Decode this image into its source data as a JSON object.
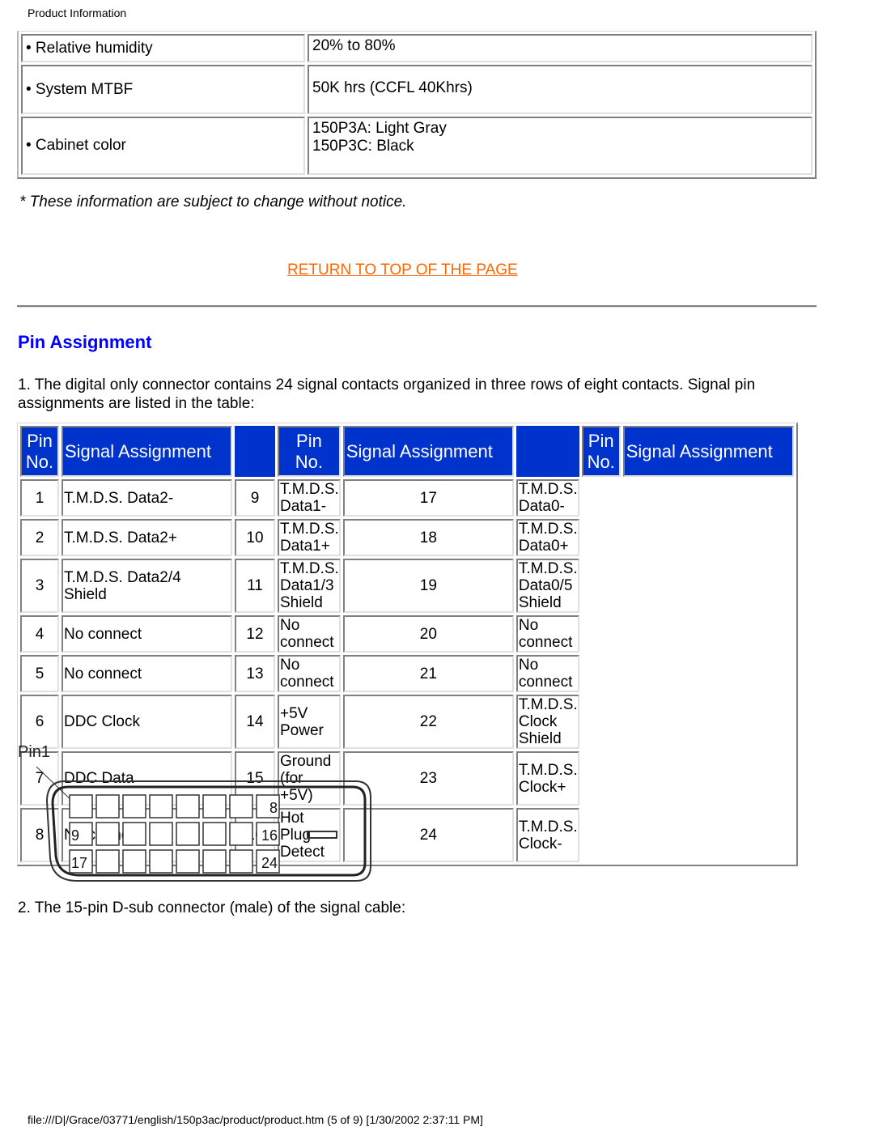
{
  "header": {
    "title": "Product Information"
  },
  "spec_table": {
    "rows": [
      {
        "label": "• Relative humidity",
        "value_lines": [
          "20% to 80%"
        ]
      },
      {
        "label": "• System MTBF",
        "value_lines": [
          "50K hrs (CCFL 40Khrs)"
        ]
      },
      {
        "label": "• Cabinet color",
        "value_lines": [
          "150P3A: Light Gray",
          "150P3C: Black"
        ]
      }
    ]
  },
  "notice": "* These information are subject to change without notice.",
  "return_link": "RETURN TO TOP OF THE PAGE",
  "section": {
    "title": "Pin Assignment",
    "intro": "1. The digital only connector contains 24 signal contacts organized in three rows of eight contacts. Signal pin assignments are listed in the table:"
  },
  "pin_table": {
    "header": {
      "pin_no_line1": "Pin",
      "pin_no_line2": "No.",
      "signal": "Signal Assignment"
    },
    "header_color": "#0033cc",
    "columns": [
      [
        {
          "pin": "1",
          "lines": [
            "T.M.D.S. Data2-"
          ]
        },
        {
          "pin": "2",
          "lines": [
            "T.M.D.S. Data2+"
          ]
        },
        {
          "pin": "3",
          "lines": [
            "T.M.D.S. Data2/4",
            "Shield"
          ]
        },
        {
          "pin": "4",
          "lines": [
            "No connect"
          ]
        },
        {
          "pin": "5",
          "lines": [
            "No connect"
          ]
        },
        {
          "pin": "6",
          "lines": [
            "DDC Clock"
          ]
        },
        {
          "pin": "7",
          "lines": [
            "DDC Data"
          ]
        },
        {
          "pin": "8",
          "lines": [
            "No connect"
          ]
        }
      ],
      [
        {
          "pin": "9",
          "lines": [
            "T.M.D.S. Data1-"
          ]
        },
        {
          "pin": "10",
          "lines": [
            "T.M.D.S. Data1+"
          ]
        },
        {
          "pin": "11",
          "lines": [
            "T.M.D.S. Data1/3",
            "Shield"
          ]
        },
        {
          "pin": "12",
          "lines": [
            "No connect"
          ]
        },
        {
          "pin": "13",
          "lines": [
            "No connect"
          ]
        },
        {
          "pin": "14",
          "lines": [
            "+5V Power"
          ]
        },
        {
          "pin": "15",
          "lines": [
            "Ground (for +5V)"
          ]
        },
        {
          "pin": "16",
          "lines": [
            "Hot Plug Detect"
          ]
        }
      ],
      [
        {
          "pin": "17",
          "lines": [
            "T.M.D.S. Data0-"
          ]
        },
        {
          "pin": "18",
          "lines": [
            "T.M.D.S. Data0+"
          ]
        },
        {
          "pin": "19",
          "lines": [
            "T.M.D.S. Data0/5",
            "Shield"
          ]
        },
        {
          "pin": "20",
          "lines": [
            "No connect"
          ]
        },
        {
          "pin": "21",
          "lines": [
            "No connect"
          ]
        },
        {
          "pin": "22",
          "lines": [
            "T.M.D.S. Clock",
            "Shield"
          ]
        },
        {
          "pin": "23",
          "lines": [
            "T.M.D.S. Clock+"
          ]
        },
        {
          "pin": "24",
          "lines": [
            "T.M.D.S. Clock-"
          ]
        }
      ]
    ]
  },
  "connector_diagram": {
    "label": "Pin1",
    "rows": 3,
    "cols": 8,
    "corner_labels": {
      "r1_last": "8",
      "r2_first": "9",
      "r2_last": "16",
      "r3_first": "17",
      "r3_last": "24"
    }
  },
  "cable_text": "2. The 15-pin D-sub connector (male) of the signal cable:",
  "footer": "file:///D|/Grace/03771/english/150p3ac/product/product.htm (5 of 9) [1/30/2002 2:37:11 PM]"
}
